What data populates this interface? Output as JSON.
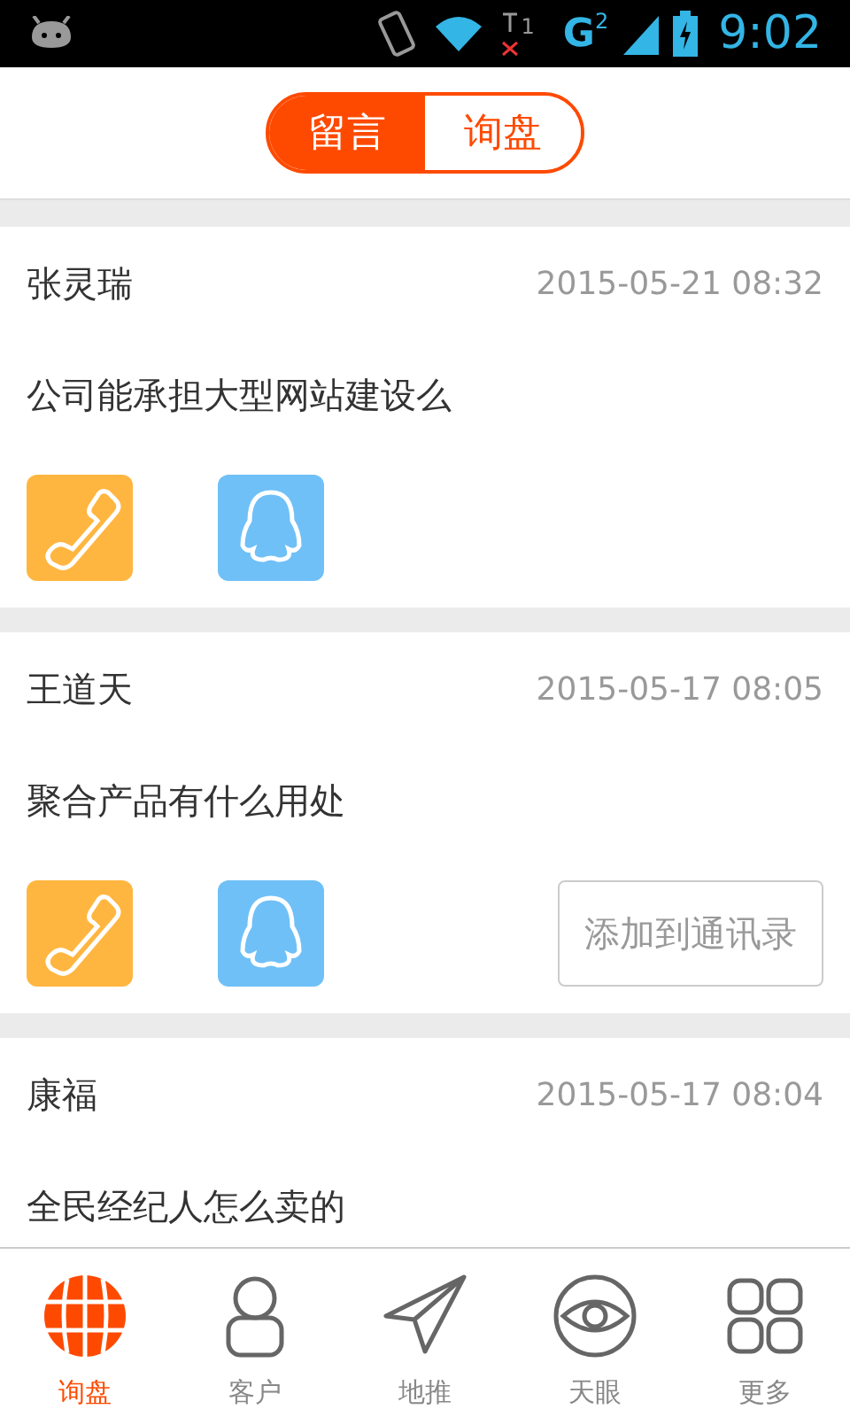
{
  "status_bar": {
    "sim1": "1",
    "network": "G",
    "sim2": "2",
    "time": "9:02"
  },
  "segments": [
    {
      "label": "留言",
      "selected": true
    },
    {
      "label": "询盘",
      "selected": false
    }
  ],
  "messages": [
    {
      "name": "张灵瑞",
      "time": "2015-05-21 08:32",
      "text": "公司能承担大型网站建设么",
      "actions": {
        "call": true,
        "qq": true
      }
    },
    {
      "name": "王道天",
      "time": "2015-05-17 08:05",
      "text": "聚合产品有什么用处",
      "actions": {
        "call": true,
        "qq": true,
        "add_contact": "添加到通讯录"
      }
    },
    {
      "name": "康福",
      "time": "2015-05-17 08:04",
      "text": "全民经纪人怎么卖的"
    }
  ],
  "bottom_nav": [
    {
      "label": "询盘",
      "kind": "globe",
      "selected": true
    },
    {
      "label": "客户",
      "kind": "person",
      "selected": false
    },
    {
      "label": "地推",
      "kind": "plane",
      "selected": false
    },
    {
      "label": "天眼",
      "kind": "eye",
      "selected": false
    },
    {
      "label": "更多",
      "kind": "grid",
      "selected": false
    }
  ]
}
